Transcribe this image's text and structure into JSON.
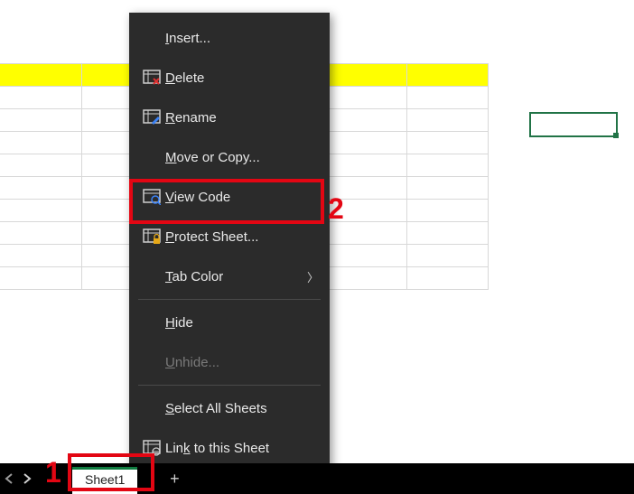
{
  "menu": {
    "insert": "Insert...",
    "delete": "Delete",
    "rename": "Rename",
    "move_copy": "Move or Copy...",
    "view_code": "View Code",
    "protect_sheet": "Protect Sheet...",
    "tab_color": "Tab Color",
    "hide": "Hide",
    "unhide": "Unhide...",
    "select_all": "Select All Sheets",
    "link_sheet": "Link to this Sheet",
    "accel": {
      "insert": "I",
      "delete": "D",
      "rename": "R",
      "move_copy": "M",
      "view_code": "V",
      "protect_sheet": "P",
      "tab_color": "T",
      "hide": "H",
      "unhide": "U",
      "select_all": "S",
      "link_sheet": "k"
    }
  },
  "tabs": {
    "active": "Sheet1",
    "add_tooltip": "+"
  },
  "annotations": {
    "n1": "1",
    "n2": "2"
  },
  "chart_data": null
}
